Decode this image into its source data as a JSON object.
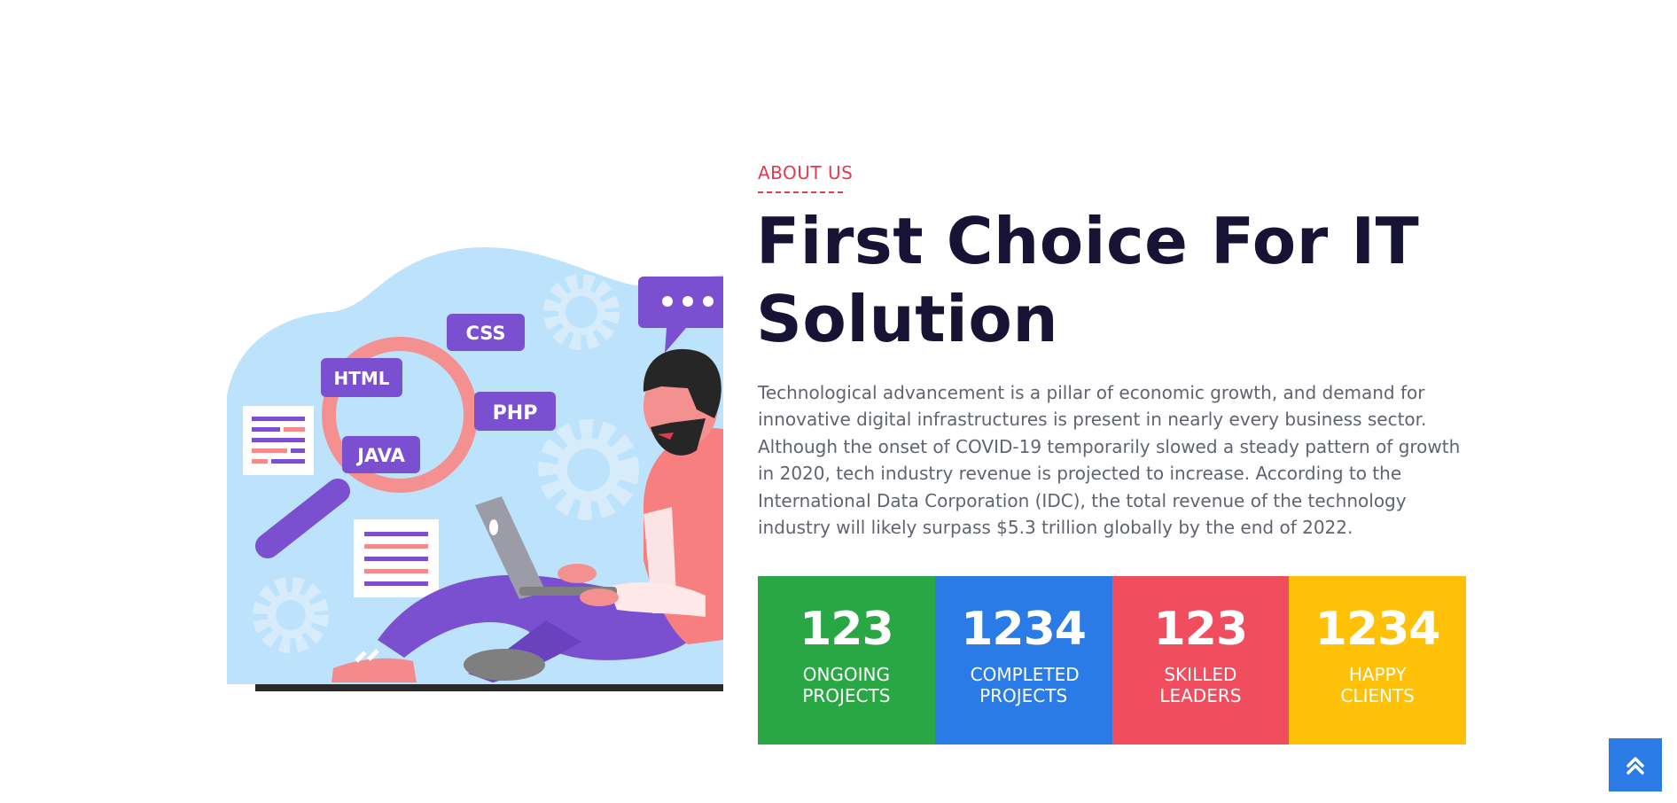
{
  "about": {
    "eyebrow": "ABOUT US",
    "title": "First Choice For IT Solution",
    "description": "Technological advancement is a pillar of economic growth, and demand for innovative digital infrastructures is present in nearly every business sector. Although the onset of COVID-19 temporarily slowed a steady pattern of growth in 2020, tech industry revenue is projected to increase. According to the International Data Corporation (IDC), the total revenue of the technology industry will likely surpass $5.3 trillion globally by the end of 2022."
  },
  "illustration": {
    "tags": [
      "HTML",
      "CSS",
      "PHP",
      "JAVA"
    ]
  },
  "stats": [
    {
      "value": "123",
      "label": "ONGOING PROJECTS",
      "color": "#29a745"
    },
    {
      "value": "1234",
      "label": "COMPLETED PROJECTS",
      "color": "#2b7be6"
    },
    {
      "value": "123",
      "label": "SKILLED LEADERS",
      "color": "#f04e5e"
    },
    {
      "value": "1234",
      "label": "HAPPY CLIENTS",
      "color": "#fec107"
    }
  ],
  "colors": {
    "accent": "#e53950",
    "heading": "#161335",
    "body_text": "#5f6470",
    "scroll_button": "#2b7be6"
  },
  "icons": {
    "scroll_top": "double-chevron-up-icon"
  }
}
